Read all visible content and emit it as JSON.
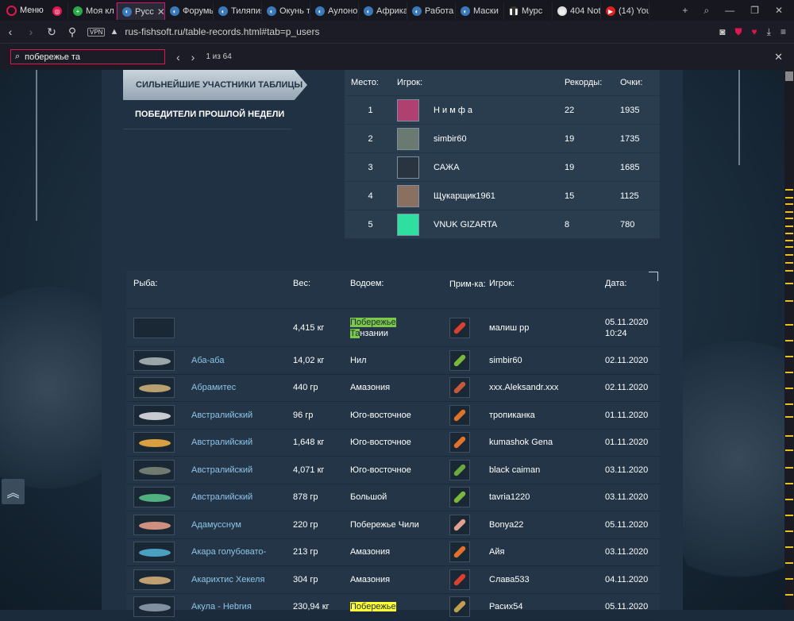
{
  "browser": {
    "menu_label": "Меню",
    "tabs": [
      {
        "label": "",
        "icon": "gamepad-icon"
      },
      {
        "label": "Моя кл",
        "icon": "plus-icon"
      },
      {
        "label": "Русс",
        "icon": "fishsoft-icon",
        "active": true
      },
      {
        "label": "Форумы",
        "icon": "fishsoft-icon"
      },
      {
        "label": "Тиляпия",
        "icon": "fishsoft-icon"
      },
      {
        "label": "Окунь т",
        "icon": "fishsoft-icon"
      },
      {
        "label": "Аулоно",
        "icon": "fishsoft-icon"
      },
      {
        "label": "Африка",
        "icon": "fishsoft-icon"
      },
      {
        "label": "Работа",
        "icon": "fishsoft-icon"
      },
      {
        "label": "Маски",
        "icon": "fishsoft-icon"
      },
      {
        "label": "Мурс",
        "icon": "pause-icon"
      },
      {
        "label": "404 Not",
        "icon": "document-icon"
      },
      {
        "label": "(14) You",
        "icon": "youtube-icon"
      }
    ],
    "url": "rus-fishsoft.ru/table-records.html#tab=p_users",
    "vpn_label": "VPN",
    "find": {
      "query": "побережье та",
      "count": "1 из 64"
    }
  },
  "menu": {
    "active_label": "СИЛЬНЕЙШИЕ УЧАСТНИКИ ТАБЛИЦЫ",
    "second_label": "ПОБЕДИТЕЛИ ПРОШЛОЙ НЕДЕЛИ"
  },
  "records": {
    "headers": {
      "place": "Место:",
      "player": "Игрок:",
      "records": "Рекорды:",
      "points": "Очки:"
    },
    "rows": [
      {
        "place": "1",
        "player": "Н и м ф а",
        "records": "22",
        "points": "1935",
        "avatar_color": "#b04070"
      },
      {
        "place": "2",
        "player": "simbir60",
        "records": "19",
        "points": "1735",
        "avatar_color": "#6a7a70"
      },
      {
        "place": "3",
        "player": "САЖА",
        "records": "19",
        "points": "1685",
        "avatar_color": "#2a3440"
      },
      {
        "place": "4",
        "player": "Щукарщик1961",
        "records": "15",
        "points": "1125",
        "avatar_color": "#8a7060"
      },
      {
        "place": "5",
        "player": "VNUK GIZARTA",
        "records": "8",
        "points": "780",
        "avatar_color": "#2ee0a0"
      }
    ]
  },
  "fish": {
    "headers": {
      "fish": "Рыба:",
      "weight": "Вес:",
      "water": "Водоем:",
      "bait": "Прим-ка:",
      "player": "Игрок:",
      "date": "Дата:"
    },
    "first_row": {
      "weight": "4,415 кг",
      "water_hl": "Побережье",
      "water_hl2": "Та",
      "water_rest": "нзании",
      "player": "малиш рр",
      "date": "05.11.2020",
      "time": "10:24"
    },
    "rows": [
      {
        "name": "Аба-аба",
        "weight": "14,02 кг",
        "water": "Нил",
        "player": "simbir60",
        "date": "02.11.2020",
        "fish_color": "#9aa6a8",
        "bait_color": "#7ab83c"
      },
      {
        "name": "Абрамитес",
        "weight": "440 гр",
        "water": "Амазония",
        "player": "xxx.Aleksandr.xxx",
        "date": "02.11.2020",
        "fish_color": "#b8a070",
        "bait_color": "#c45a3a"
      },
      {
        "name": "Австралийский",
        "weight": "96 гр",
        "water": "Юго-восточное",
        "player": "тропиканка",
        "date": "01.11.2020",
        "fish_color": "#c8ccd0",
        "bait_color": "#e0722a"
      },
      {
        "name": "Австралийский",
        "weight": "1,648 кг",
        "water": "Юго-восточное",
        "player": "kumashok Gena",
        "date": "01.11.2020",
        "fish_color": "#d8a040",
        "bait_color": "#e0722a"
      },
      {
        "name": "Австралийский",
        "weight": "4,071 кг",
        "water": "Юго-восточное",
        "player": "black caiman",
        "date": "03.11.2020",
        "fish_color": "#707a70",
        "bait_color": "#6aa840"
      },
      {
        "name": "Австралийский",
        "weight": "878 гр",
        "water": "Большой",
        "player": "tavria1220",
        "date": "03.11.2020",
        "fish_color": "#50b080",
        "bait_color": "#7ab83c"
      },
      {
        "name": "Адамусснум",
        "weight": "220 гр",
        "water": "Побережье Чили",
        "player": "Bonya22",
        "date": "05.11.2020",
        "fish_color": "#d09080",
        "bait_color": "#e0a090"
      },
      {
        "name": "Акара голубовато-",
        "weight": "213 гр",
        "water": "Амазония",
        "player": "Айя",
        "date": "03.11.2020",
        "fish_color": "#4aa0c0",
        "bait_color": "#e0722a"
      },
      {
        "name": "Акарихтис Хекеля",
        "weight": "304 гр",
        "water": "Амазония",
        "player": "Слава533",
        "date": "04.11.2020",
        "fish_color": "#c0a070",
        "bait_color": "#d84030"
      },
      {
        "name": "Акула - Нebrия",
        "weight": "230,94 кг",
        "water": "Побережье",
        "player": "Расих54",
        "date": "05.11.2020",
        "fish_color": "#8090a0",
        "bait_color": "#c0a050",
        "highlight": true
      }
    ]
  }
}
